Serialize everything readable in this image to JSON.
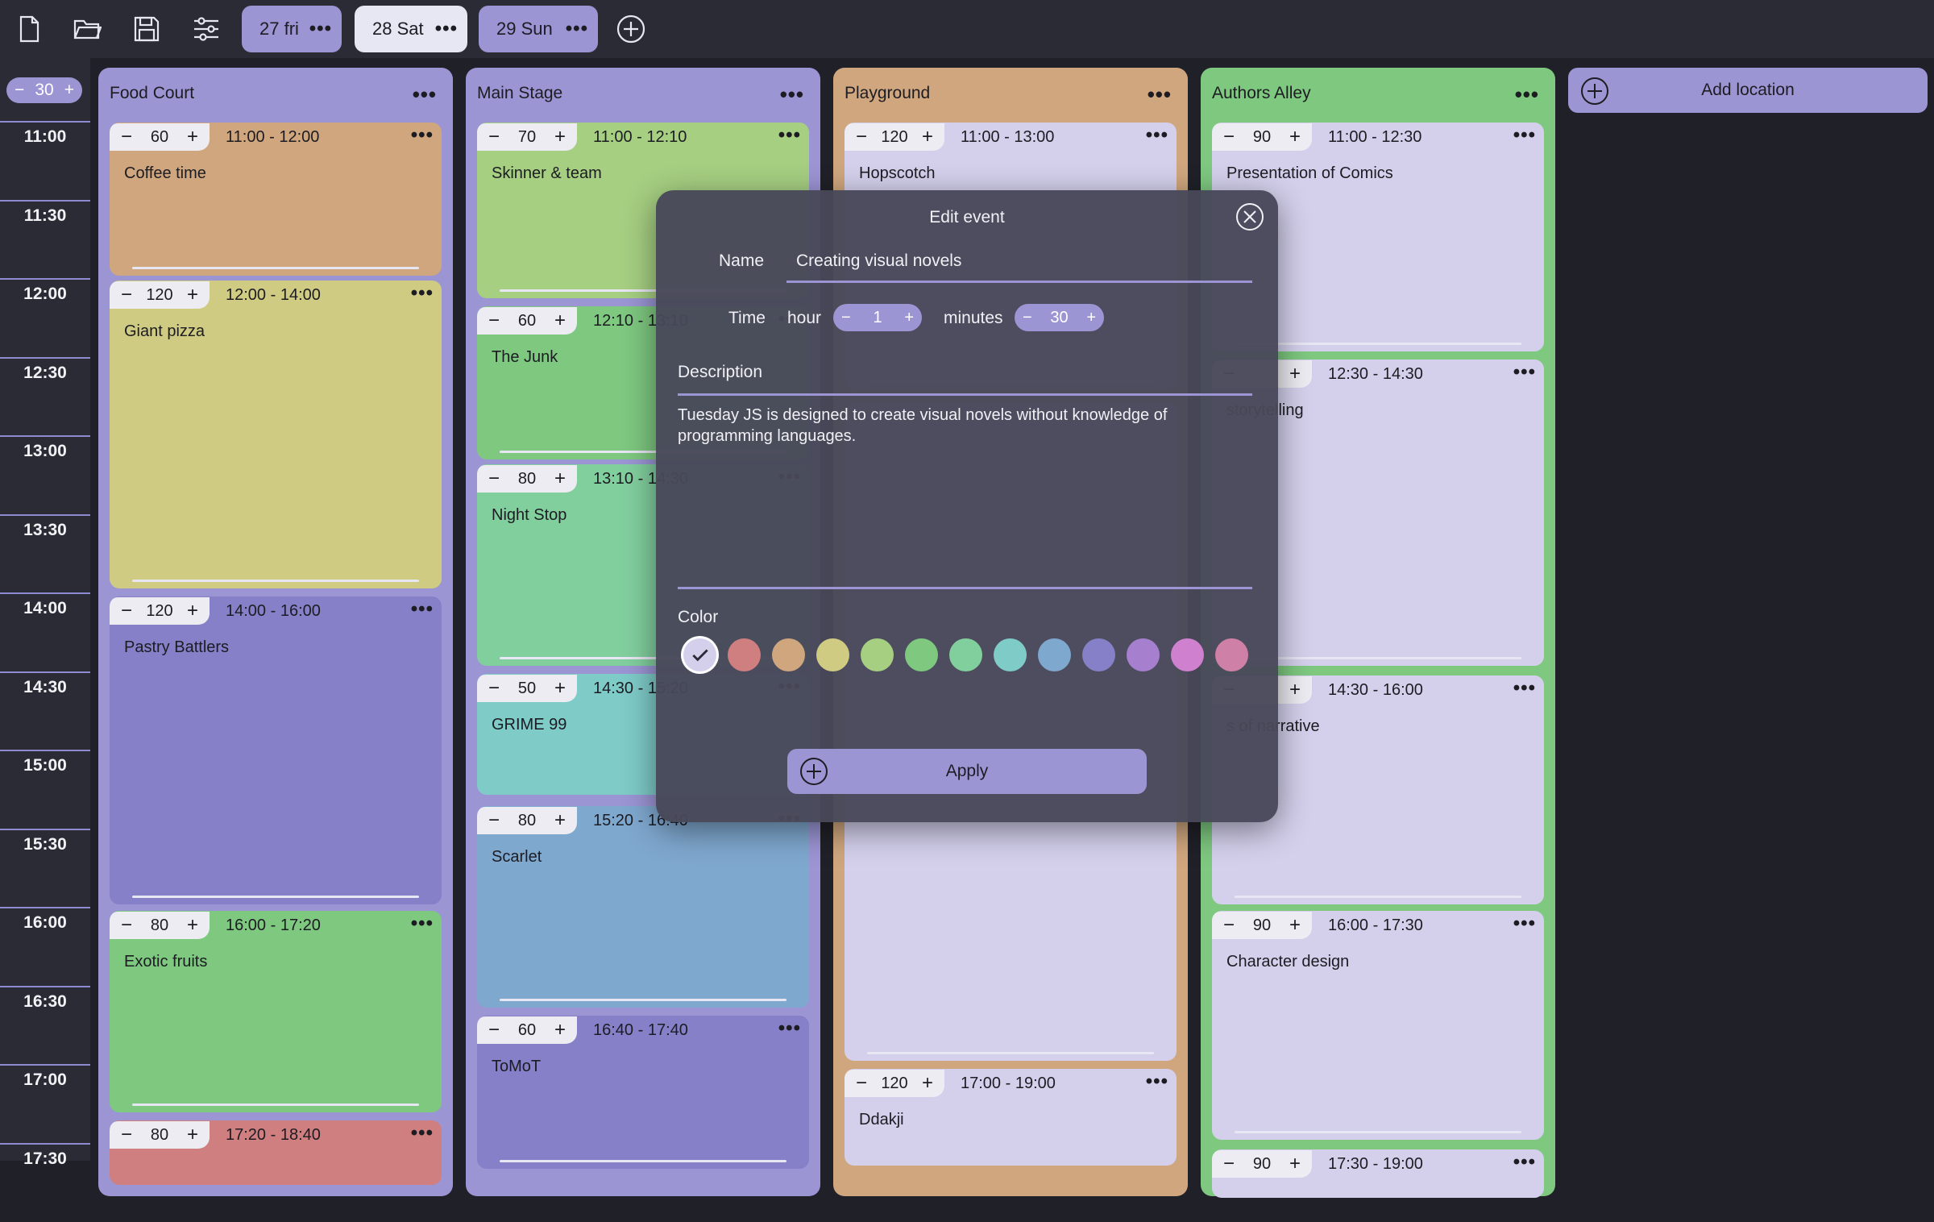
{
  "toolbar": {
    "icons": [
      "new-file-icon",
      "open-folder-icon",
      "save-icon",
      "settings-sliders-icon"
    ],
    "days": [
      {
        "label": "27 fri",
        "active": false
      },
      {
        "label": "28 Sat",
        "active": true
      },
      {
        "label": "29 Sun",
        "active": false
      }
    ],
    "dots": "•••"
  },
  "zoom": {
    "minus": "−",
    "value": "30",
    "plus": "+"
  },
  "times": [
    "11:00",
    "11:30",
    "12:00",
    "12:30",
    "13:00",
    "13:30",
    "14:00",
    "14:30",
    "15:00",
    "15:30",
    "16:00",
    "16:30",
    "17:00",
    "17:30"
  ],
  "columns": [
    {
      "name": "Food Court",
      "color": "#9b95d4",
      "events": [
        {
          "duration": "60",
          "time": "11:00 - 12:00",
          "title": "Coffee time",
          "color": "#cfa67e"
        },
        {
          "duration": "120",
          "time": "12:00 - 14:00",
          "title": "Giant pizza",
          "color": "#cfcb82"
        },
        {
          "duration": "120",
          "time": "14:00 - 16:00",
          "title": "Pastry Battlers",
          "color": "#8580c8"
        },
        {
          "duration": "80",
          "time": "16:00 - 17:20",
          "title": "Exotic fruits",
          "color": "#7ec880"
        },
        {
          "duration": "80",
          "time": "17:20 - 18:40",
          "title": "",
          "color": "#cf7f7f"
        }
      ]
    },
    {
      "name": "Main Stage",
      "color": "#9b95d4",
      "events": [
        {
          "duration": "70",
          "time": "11:00 - 12:10",
          "title": "Skinner & team",
          "color": "#a6cf82"
        },
        {
          "duration": "60",
          "time": "12:10 - 13:10",
          "title": "The Junk",
          "color": "#7ec880"
        },
        {
          "duration": "80",
          "time": "13:10 - 14:30",
          "title": "Night Stop",
          "color": "#82cf9e"
        },
        {
          "duration": "50",
          "time": "14:30 - 15:20",
          "title": "GRIME 99",
          "color": "#7ecbc8"
        },
        {
          "duration": "80",
          "time": "15:20 - 16:40",
          "title": "Scarlet",
          "color": "#7fa8cf"
        },
        {
          "duration": "60",
          "time": "16:40 - 17:40",
          "title": "ToMoT",
          "color": "#8580c8"
        }
      ]
    },
    {
      "name": "Playground",
      "color": "#cfa67e",
      "events": [
        {
          "duration": "120",
          "time": "11:00 - 13:00",
          "title": "Hopscotch",
          "color": "#d4d0ec"
        },
        {
          "duration": "",
          "time": "",
          "title": "",
          "color": "#d4d0ec"
        },
        {
          "duration": "120",
          "time": "17:00 - 19:00",
          "title": "Ddakji",
          "color": "#d4d0ec"
        }
      ]
    },
    {
      "name": "Authors Alley",
      "color": "#7ec880",
      "events": [
        {
          "duration": "90",
          "time": "11:00 - 12:30",
          "title": "Presentation of Comics",
          "color": "#d4d0ec"
        },
        {
          "duration": "",
          "time": "12:30 - 14:30",
          "title": "storytelling",
          "color": "#d4d0ec"
        },
        {
          "duration": "",
          "time": "14:30 - 16:00",
          "title": "s of narrative",
          "color": "#d4d0ec"
        },
        {
          "duration": "90",
          "time": "16:00 - 17:30",
          "title": "Character design",
          "color": "#d4d0ec"
        },
        {
          "duration": "90",
          "time": "17:30 - 19:00",
          "title": "",
          "color": "#d4d0ec"
        }
      ]
    }
  ],
  "add_location": {
    "label": "Add location"
  },
  "modal": {
    "title": "Edit event",
    "name_label": "Name",
    "name_value": "Creating visual novels",
    "time_label": "Time",
    "hour_label": "hour",
    "hour_value": "1",
    "minutes_label": "minutes",
    "minutes_value": "30",
    "description_label": "Description",
    "description": "Tuesday JS is designed to create visual novels without knowledge of programming languages.",
    "color_label": "Color",
    "colors": [
      "#d4d0ec",
      "#cf7f7f",
      "#cfa67e",
      "#cfcb82",
      "#a6cf82",
      "#7ec880",
      "#82cf9e",
      "#7ecbc8",
      "#7fa8cf",
      "#8580c8",
      "#a680cf",
      "#cf80cf",
      "#cf80a6"
    ],
    "selected_color": "#d4d0ec",
    "apply_label": "Apply"
  }
}
